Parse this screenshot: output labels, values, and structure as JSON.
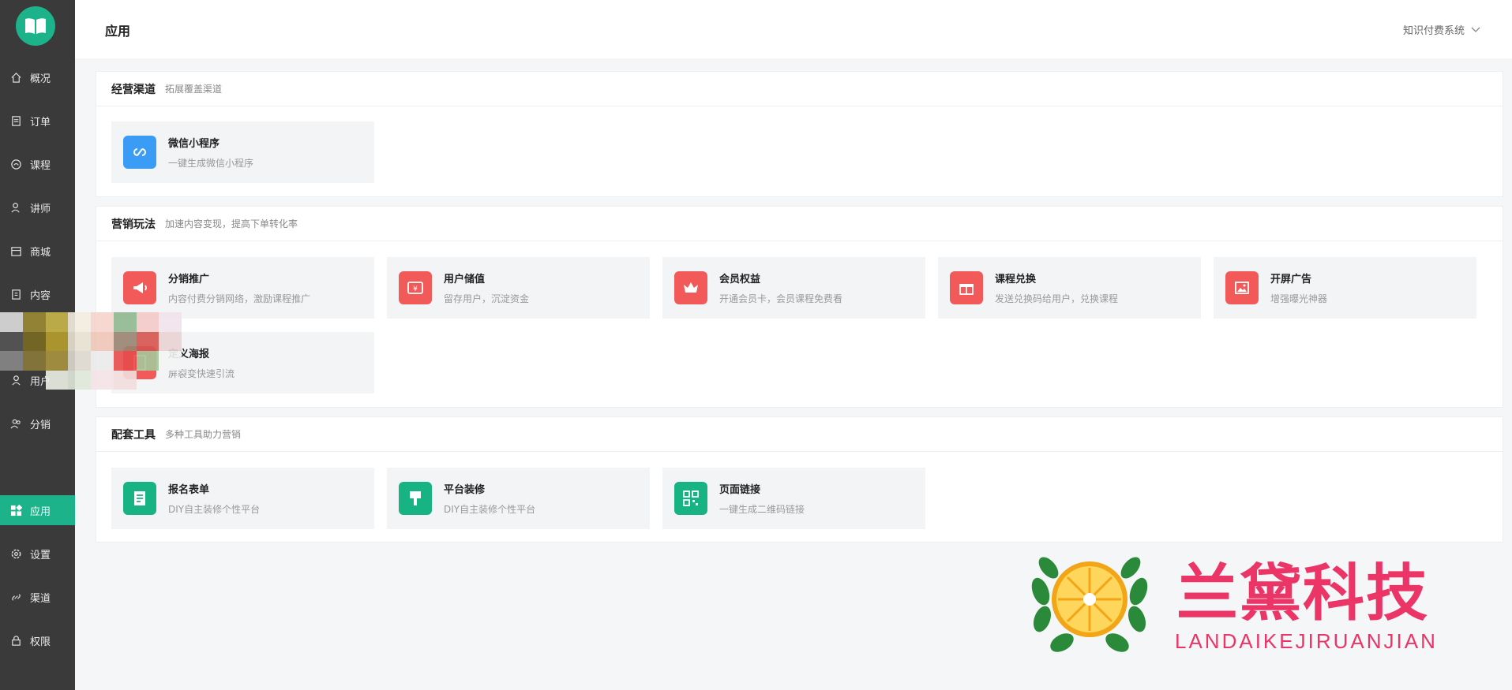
{
  "sidebar": {
    "items": [
      {
        "label": "概况",
        "icon": "home-icon"
      },
      {
        "label": "订单",
        "icon": "order-icon"
      },
      {
        "label": "课程",
        "icon": "course-icon"
      },
      {
        "label": "讲师",
        "icon": "teacher-icon"
      },
      {
        "label": "商城",
        "icon": "shop-icon"
      },
      {
        "label": "内容",
        "icon": "content-icon"
      },
      {
        "label": "用户",
        "icon": "user-icon"
      },
      {
        "label": "分销",
        "icon": "distribution-icon"
      },
      {
        "label": "应用",
        "icon": "app-icon",
        "active": true
      },
      {
        "label": "设置",
        "icon": "gear-icon"
      },
      {
        "label": "渠道",
        "icon": "link-icon"
      },
      {
        "label": "权限",
        "icon": "lock-icon"
      }
    ]
  },
  "header": {
    "title": "应用",
    "system": "知识付费系统"
  },
  "sections": [
    {
      "title": "经营渠道",
      "subtitle": "拓展覆盖渠道",
      "cards": [
        {
          "name": "微信小程序",
          "desc": "一键生成微信小程序",
          "icon": "mini-program-icon",
          "color": "#3b9cf5"
        }
      ]
    },
    {
      "title": "营销玩法",
      "subtitle": "加速内容变现，提高下单转化率",
      "cards": [
        {
          "name": "分销推广",
          "desc": "内容付费分销网络，激励课程推广",
          "icon": "megaphone-icon",
          "color": "#f25a5a"
        },
        {
          "name": "用户储值",
          "desc": "留存用户，沉淀资金",
          "icon": "wallet-icon",
          "color": "#f25a5a"
        },
        {
          "name": "会员权益",
          "desc": "开通会员卡，会员课程免费看",
          "icon": "crown-icon",
          "color": "#f25a5a"
        },
        {
          "name": "课程兑换",
          "desc": "发送兑换码给用户，兑换课程",
          "icon": "gift-icon",
          "color": "#f25a5a"
        },
        {
          "name": "开屏广告",
          "desc": "增强曝光神器",
          "icon": "image-icon",
          "color": "#f25a5a"
        },
        {
          "name": "定义海报",
          "desc": "屏裂变快速引流",
          "icon": "poster-icon",
          "color": "#f25a5a"
        }
      ]
    },
    {
      "title": "配套工具",
      "subtitle": "多种工具助力营销",
      "cards": [
        {
          "name": "报名表单",
          "desc": "DIY自主装修个性平台",
          "icon": "form-icon",
          "color": "#17b383"
        },
        {
          "name": "平台装修",
          "desc": "DIY自主装修个性平台",
          "icon": "brush-icon",
          "color": "#17b383"
        },
        {
          "name": "页面链接",
          "desc": "一键生成二维码链接",
          "icon": "qrcode-icon",
          "color": "#17b383"
        }
      ]
    }
  ],
  "watermark": {
    "cn": "兰黛科技",
    "en": "LANDAIKEJIRUANJIAN"
  }
}
